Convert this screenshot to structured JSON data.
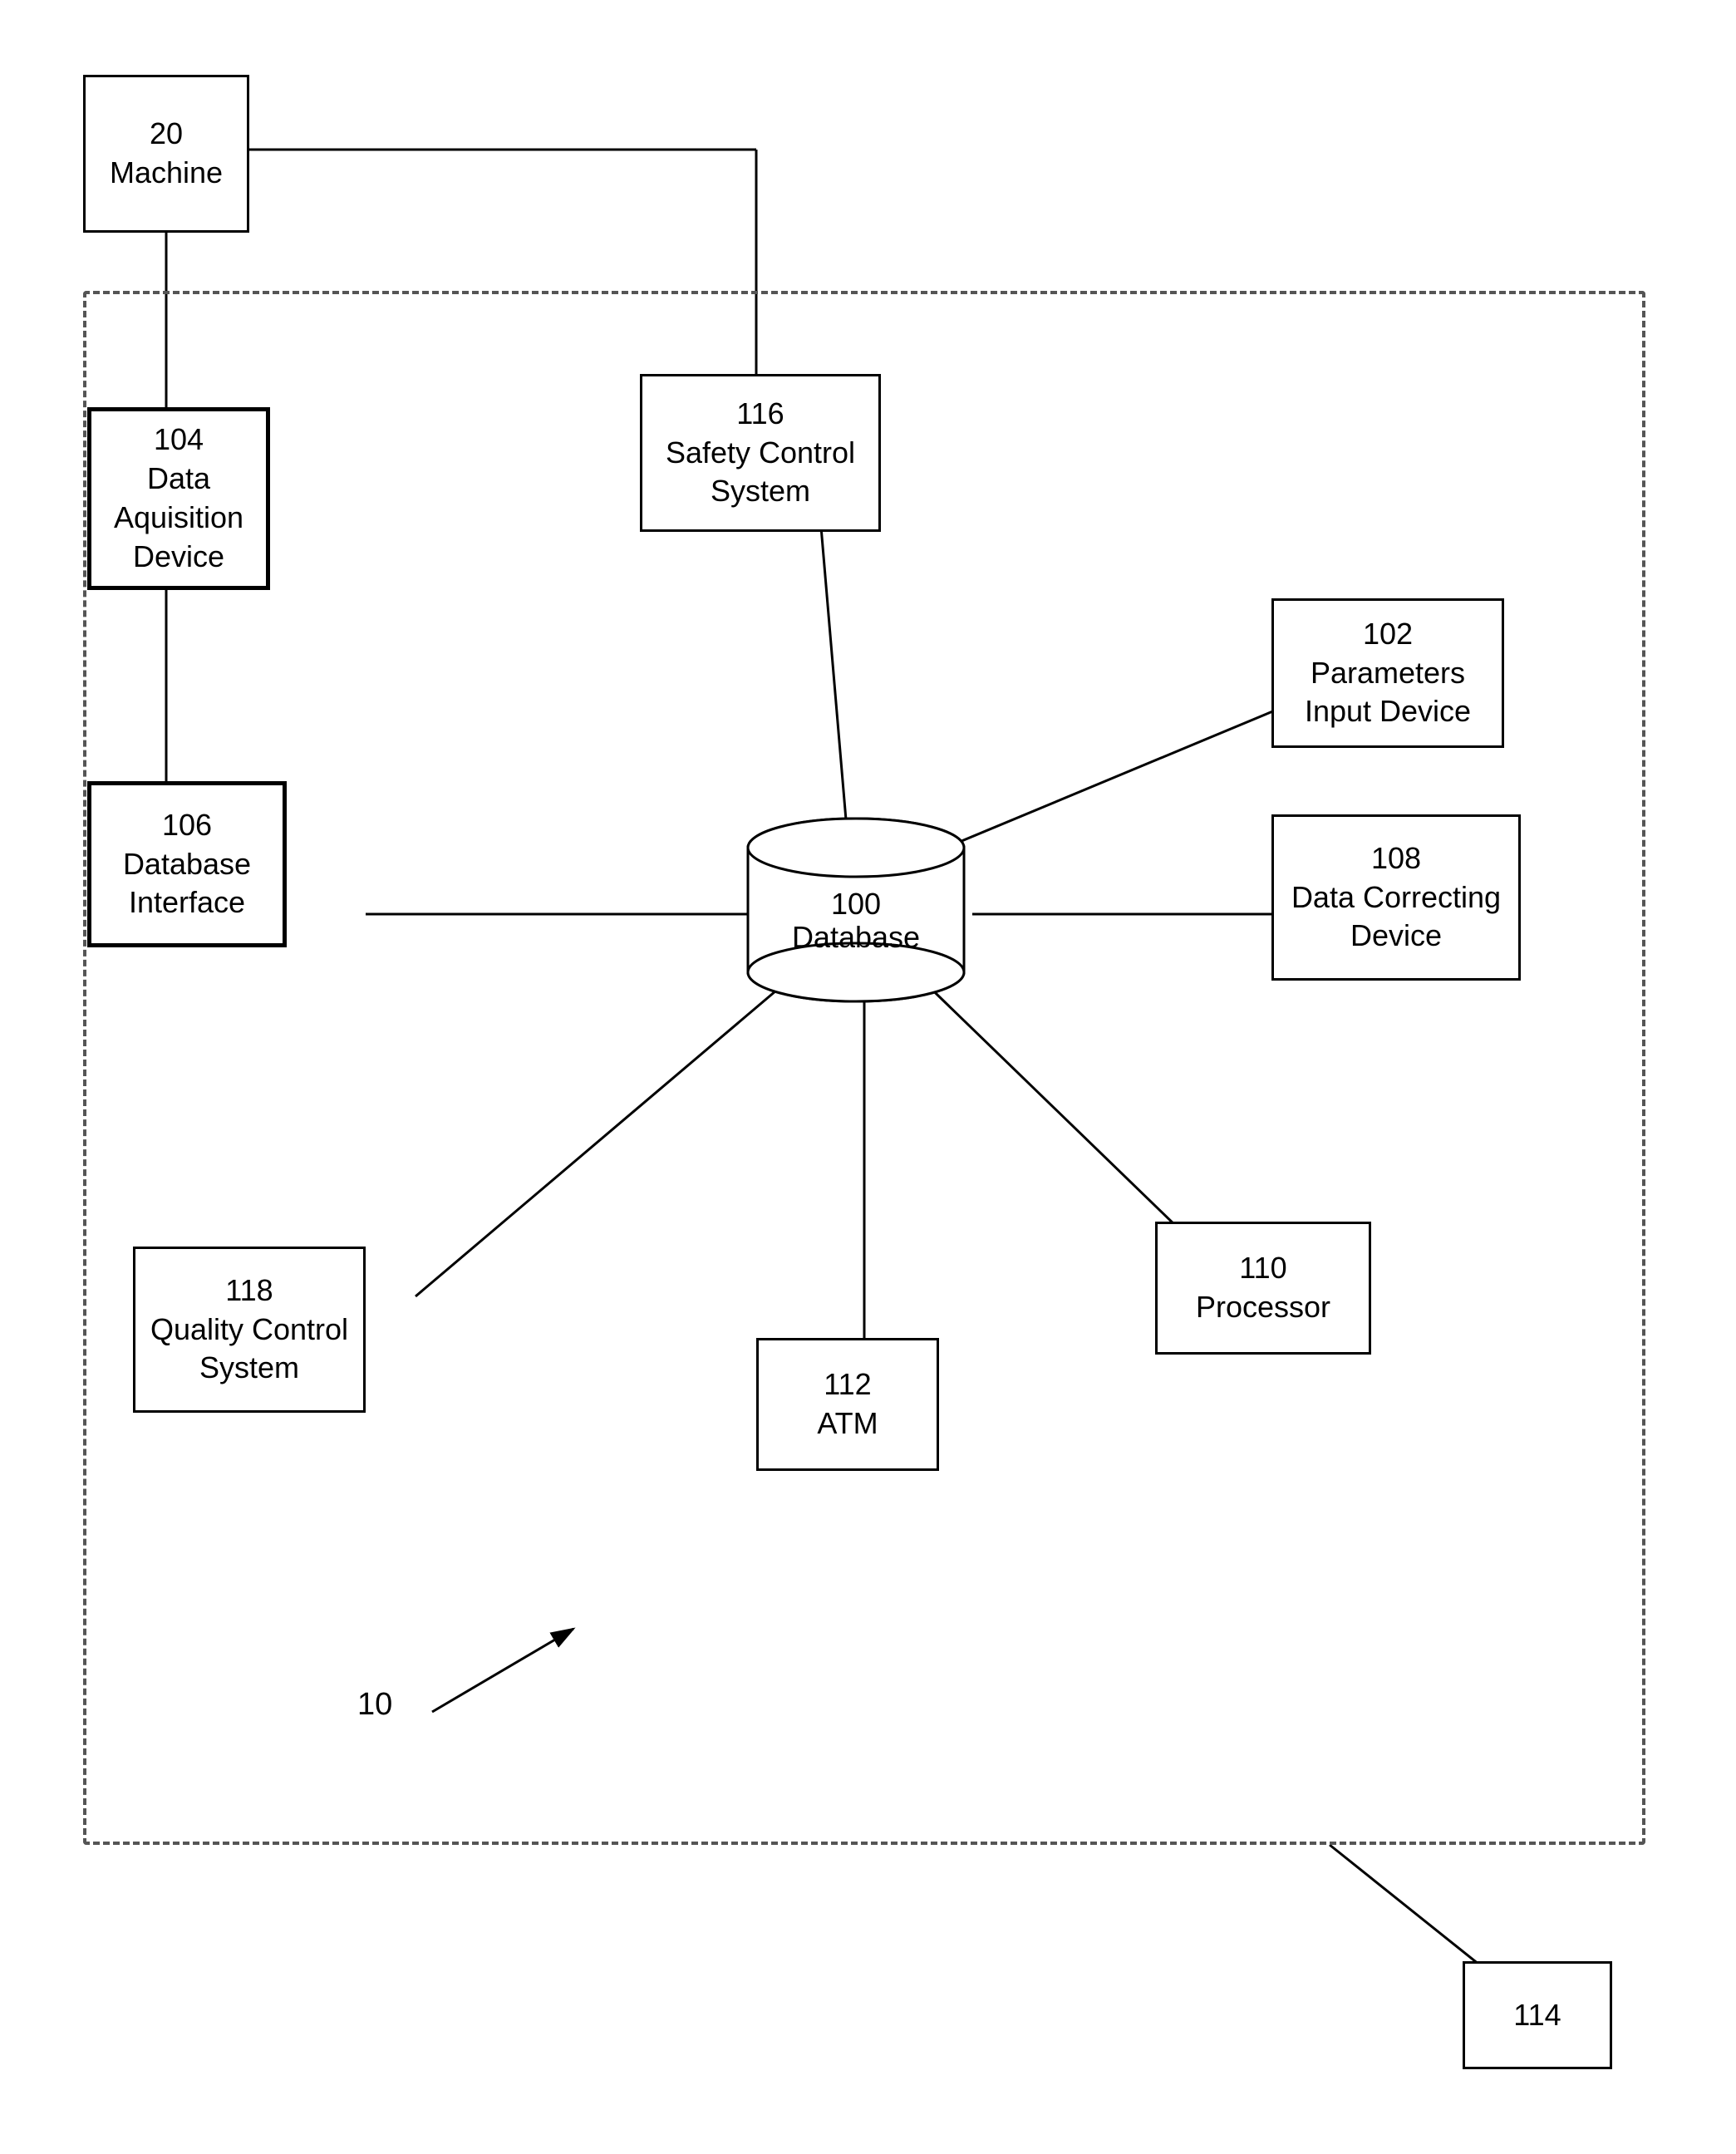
{
  "nodes": {
    "machine": {
      "label": "20\nMachine",
      "id": "machine"
    },
    "data_acquisition": {
      "label": "104\nData\nAquisition\nDevice",
      "id": "data_acquisition"
    },
    "safety_control": {
      "label": "116\nSafety Control\nSystem",
      "id": "safety_control"
    },
    "parameters_input": {
      "label": "102\nParameters\nInput Device",
      "id": "parameters_input"
    },
    "database_interface": {
      "label": "106\nDatabase\nInterface",
      "id": "database_interface"
    },
    "database": {
      "label": "100\nDatabase",
      "id": "database"
    },
    "data_correcting": {
      "label": "108\nData Correcting\nDevice",
      "id": "data_correcting"
    },
    "quality_control": {
      "label": "118\nQuality Control\nSystem",
      "id": "quality_control"
    },
    "processor": {
      "label": "110\nProcessor",
      "id": "processor"
    },
    "atm": {
      "label": "112\nATM",
      "id": "atm"
    },
    "node114": {
      "label": "114",
      "id": "node114"
    }
  },
  "labels": {
    "system_label": "10"
  }
}
